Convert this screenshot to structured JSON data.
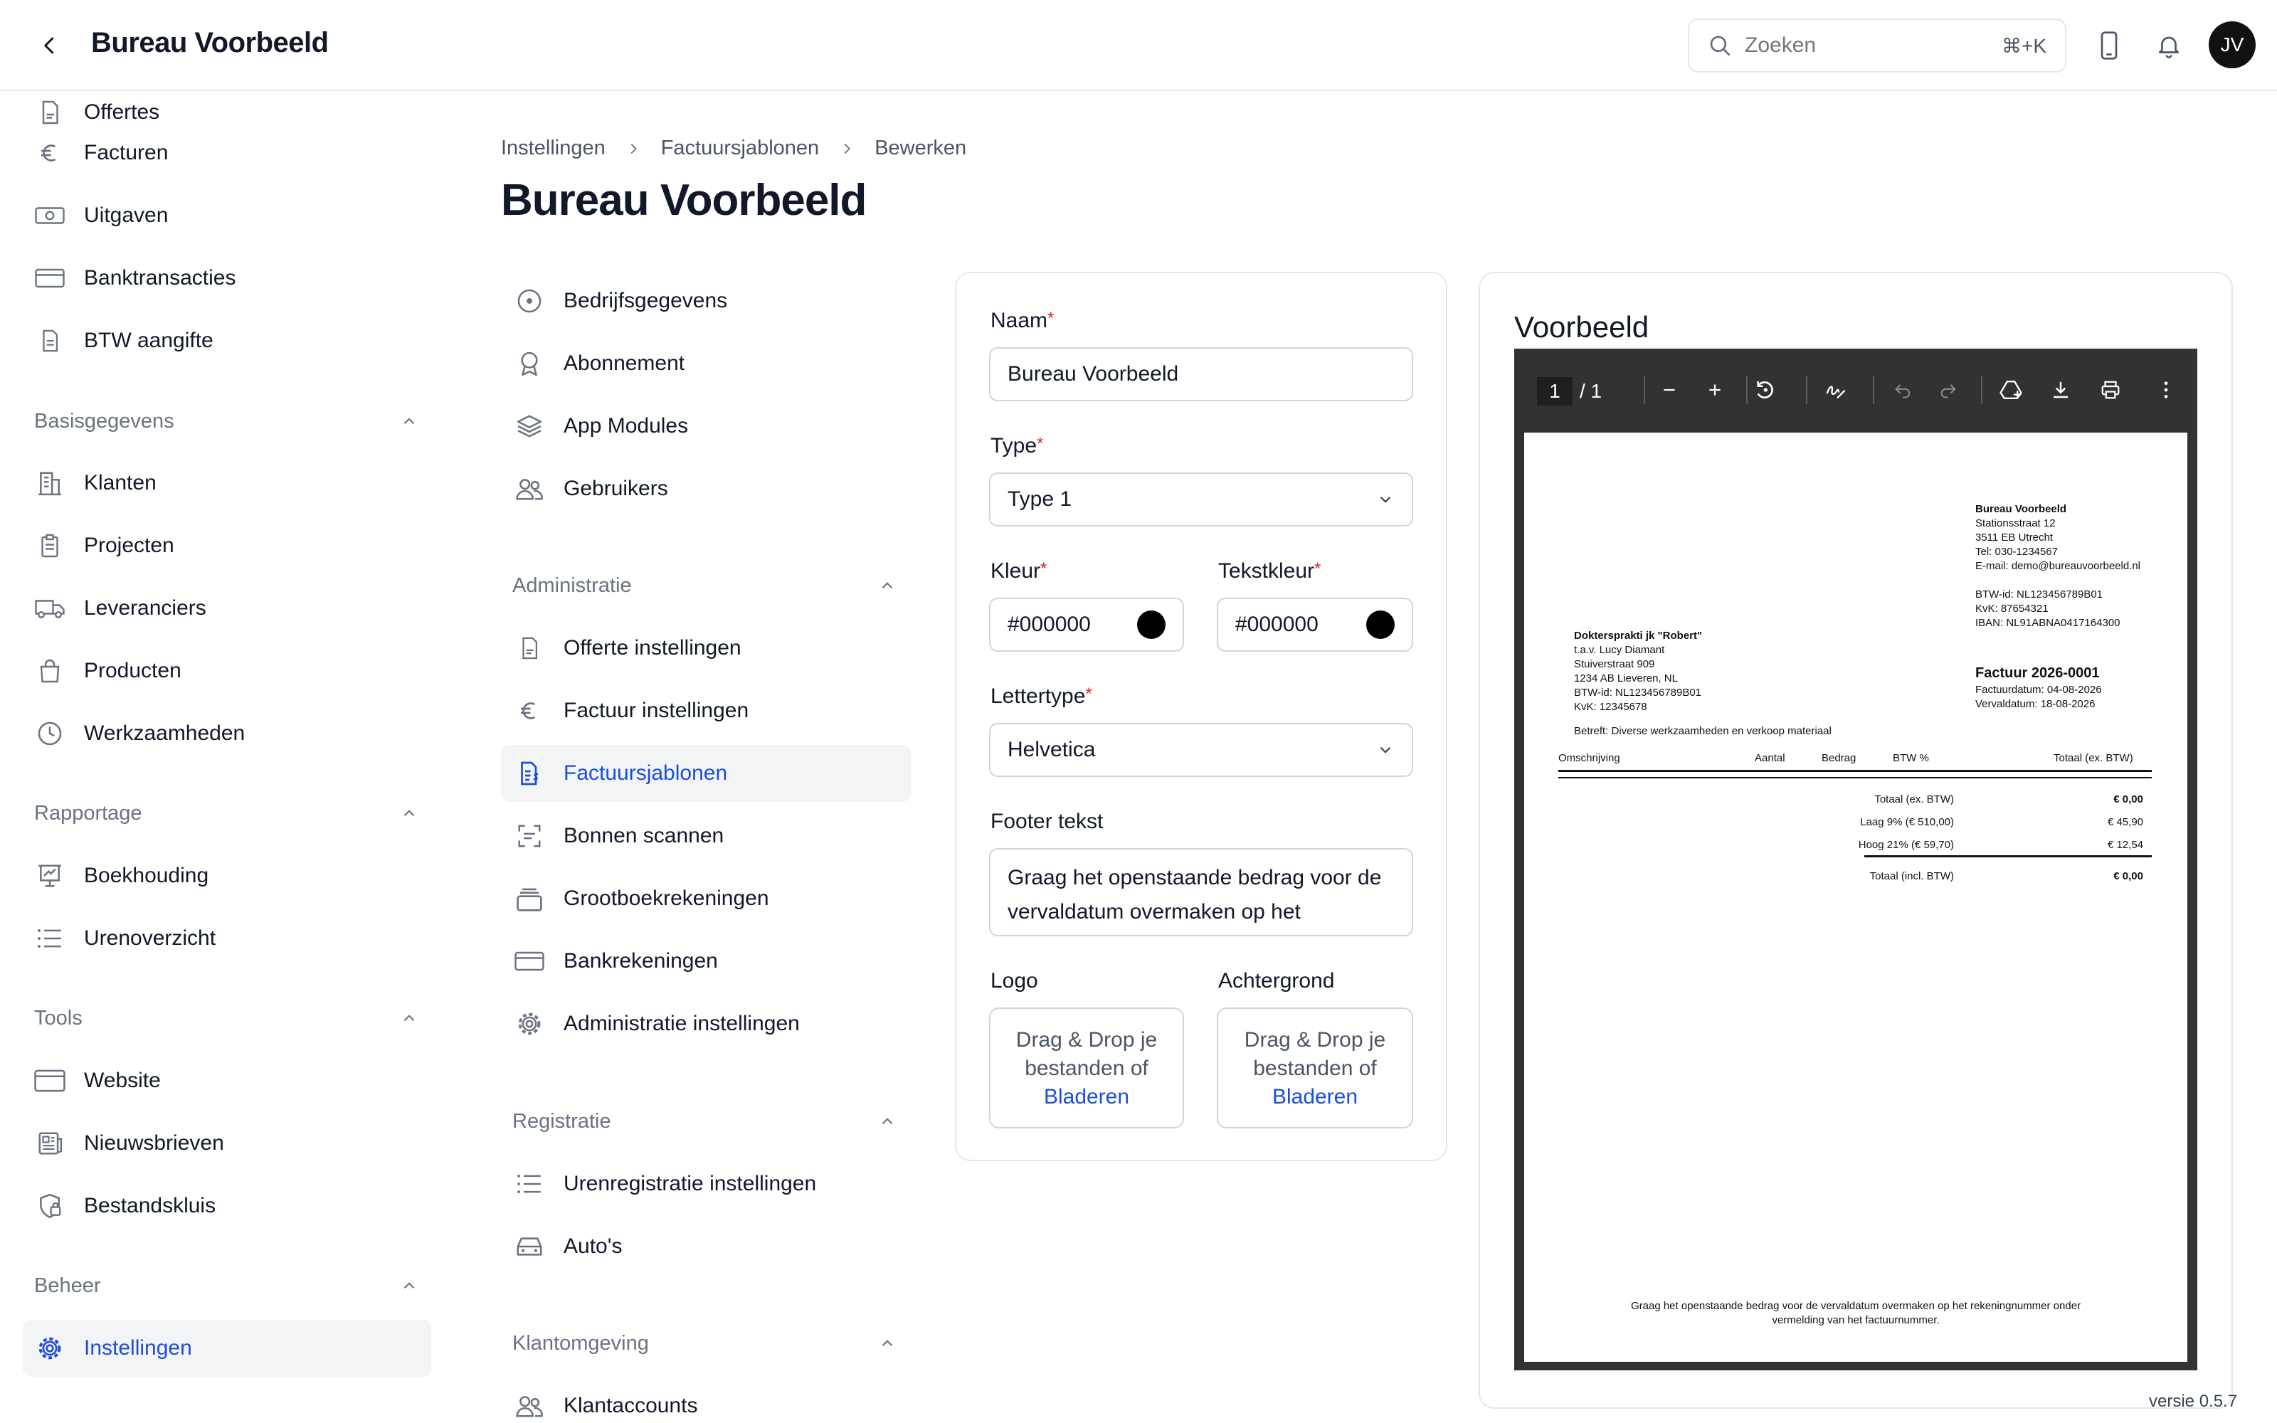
{
  "header": {
    "title": "Bureau Voorbeeld",
    "search_placeholder": "Zoeken",
    "search_shortcut": "⌘+K",
    "avatar_initials": "JV"
  },
  "sidebar": {
    "items_top": [
      {
        "label": "Offertes",
        "icon": "quote-doc-icon"
      },
      {
        "label": "Facturen",
        "icon": "euro-icon"
      },
      {
        "label": "Uitgaven",
        "icon": "banknote-icon"
      },
      {
        "label": "Banktransacties",
        "icon": "card-icon"
      },
      {
        "label": "BTW aangifte",
        "icon": "document-icon"
      }
    ],
    "sections": [
      {
        "label": "Basisgegevens",
        "items": [
          "Klanten",
          "Projecten",
          "Leveranciers",
          "Producten",
          "Werkzaamheden"
        ]
      },
      {
        "label": "Rapportage",
        "items": [
          "Boekhouding",
          "Urenoverzicht"
        ]
      },
      {
        "label": "Tools",
        "items": [
          "Website",
          "Nieuwsbrieven",
          "Bestandskluis"
        ]
      },
      {
        "label": "Beheer",
        "items": [
          "Instellingen"
        ]
      }
    ],
    "active": "Instellingen"
  },
  "breadcrumb": [
    "Instellingen",
    "Factuursjablonen",
    "Bewerken"
  ],
  "page_title": "Bureau Voorbeeld",
  "subnav": {
    "top_items": [
      "Bedrijfsgegevens",
      "Abonnement",
      "App Modules",
      "Gebruikers"
    ],
    "sections": [
      {
        "label": "Administratie",
        "items": [
          "Offerte instellingen",
          "Factuur instellingen",
          "Factuursjablonen",
          "Bonnen scannen",
          "Grootboekrekeningen",
          "Bankrekeningen",
          "Administratie instellingen"
        ]
      },
      {
        "label": "Registratie",
        "items": [
          "Urenregistratie instellingen",
          "Auto's"
        ]
      },
      {
        "label": "Klantomgeving",
        "items": [
          "Klantaccounts"
        ]
      }
    ],
    "active": "Factuursjablonen"
  },
  "form": {
    "name_label": "Naam",
    "name_value": "Bureau Voorbeeld",
    "type_label": "Type",
    "type_value": "Type 1",
    "color_label": "Kleur",
    "color_value": "#000000",
    "textcolor_label": "Tekstkleur",
    "textcolor_value": "#000000",
    "font_label": "Lettertype",
    "font_value": "Helvetica",
    "footer_label": "Footer tekst",
    "footer_value": "Graag het openstaande bedrag voor de vervaldatum overmaken op het",
    "logo_label": "Logo",
    "background_label": "Achtergrond",
    "dropzone_text": "Drag & Drop je bestanden of",
    "browse_label": "Bladeren",
    "required_mark": "*"
  },
  "preview": {
    "title": "Voorbeeld",
    "page_current": "1",
    "page_total": "/ 1",
    "invoice": {
      "company_name": "Bureau Voorbeeld",
      "company_lines": [
        "Stationsstraat 12",
        "3511 EB Utrecht",
        "Tel: 030-1234567",
        "E-mail: demo@bureauvoorbeeld.nl"
      ],
      "company_ids": [
        "BTW-id: NL123456789B01",
        "KvK: 87654321",
        "IBAN: NL91ABNA0417164300"
      ],
      "client_name": "Doktersprakti jk \"Robert\"",
      "client_lines": [
        "t.a.v. Lucy Diamant",
        "Stuiverstraat 909",
        "1234 AB Lieveren, NL",
        "BTW-id: NL123456789B01",
        "KvK: 12345678"
      ],
      "invoice_title": "Factuur 2026-0001",
      "invoice_date": "Factuurdatum: 04-08-2026",
      "due_date": "Vervaldatum: 18-08-2026",
      "subject": "Betreft: Diverse werkzaamheden en verkoop materiaal",
      "columns": [
        "Omschrijving",
        "Aantal",
        "Bedrag",
        "BTW %",
        "Totaal (ex. BTW)"
      ],
      "totals": [
        {
          "label": "Totaal (ex. BTW)",
          "value": "€ 0,00"
        },
        {
          "label": "Laag 9% (€ 510,00)",
          "value": "€ 45,90"
        },
        {
          "label": "Hoog 21% (€ 59,70)",
          "value": "€ 12,54"
        }
      ],
      "grand_total_label": "Totaal (incl. BTW)",
      "grand_total_value": "€ 0,00",
      "footer_line1": "Graag het openstaande bedrag voor de vervaldatum overmaken op het rekeningnummer onder",
      "footer_line2": "vermelding van het factuurnummer."
    }
  },
  "version": "versie 0.5.7"
}
